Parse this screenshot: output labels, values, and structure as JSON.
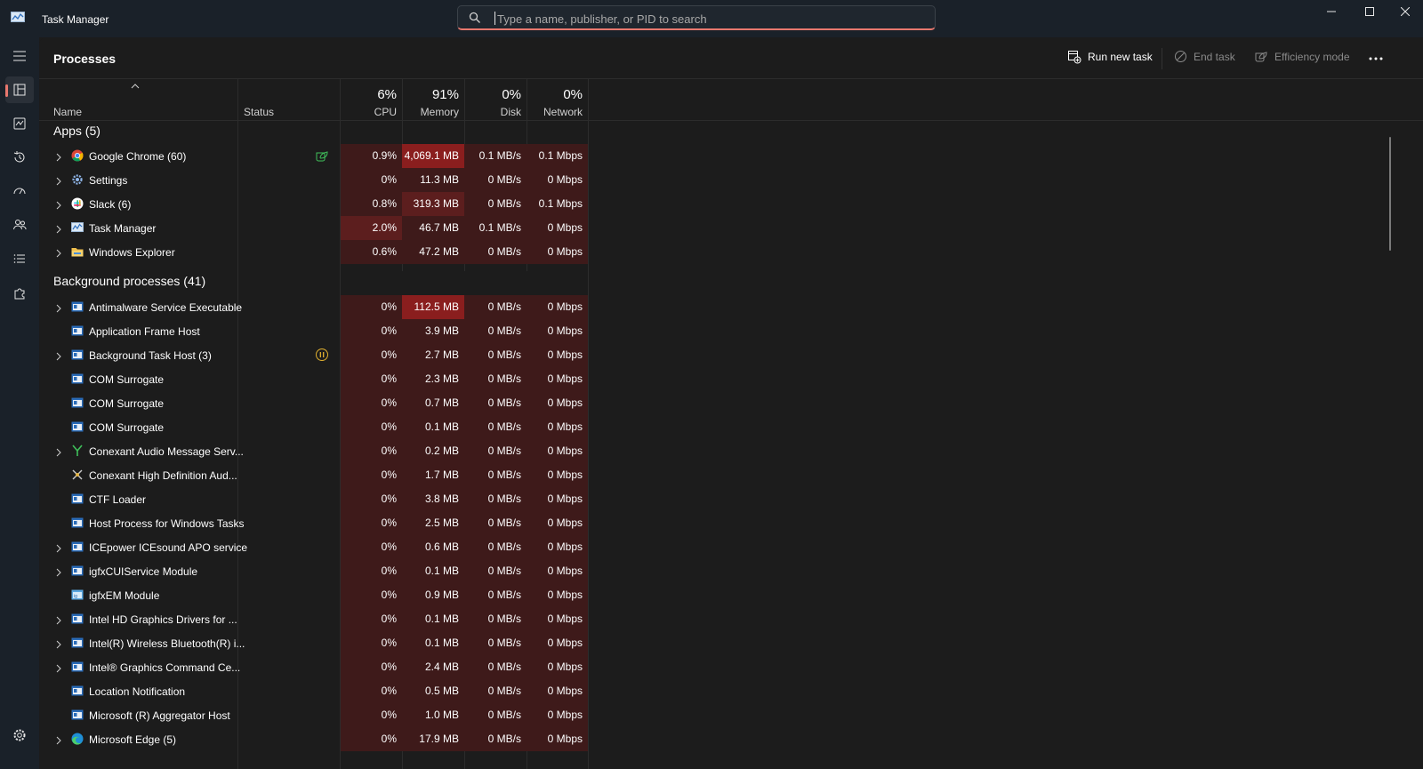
{
  "window": {
    "title": "Task Manager"
  },
  "search": {
    "placeholder": "Type a name, publisher, or PID to search"
  },
  "page": {
    "title": "Processes"
  },
  "toolbar": {
    "run_new_task": "Run new task",
    "end_task": "End task",
    "efficiency_mode": "Efficiency mode"
  },
  "columns": {
    "name": "Name",
    "status": "Status",
    "cpu": {
      "pct": "6%",
      "label": "CPU"
    },
    "memory": {
      "pct": "91%",
      "label": "Memory"
    },
    "disk": {
      "pct": "0%",
      "label": "Disk"
    },
    "network": {
      "pct": "0%",
      "label": "Network"
    }
  },
  "groups": {
    "apps": "Apps (5)",
    "background": "Background processes (41)"
  },
  "colors": {
    "accent": "#e8786e",
    "heat_low": "#3e1a1a",
    "heat_mid": "#5c1e1e",
    "heat_high": "#8a1e1e"
  },
  "rows": [
    {
      "name": "Google Chrome (60)",
      "icon": "chrome-icon",
      "expandable": true,
      "status": "efficiency-mode-icon",
      "cpu": "0.9%",
      "memory": "4,069.1 MB",
      "disk": "0.1 MB/s",
      "network": "0.1 Mbps",
      "memHeat": "high"
    },
    {
      "name": "Settings",
      "icon": "settings-gear-icon",
      "expandable": true,
      "cpu": "0%",
      "memory": "11.3 MB",
      "disk": "0 MB/s",
      "network": "0 Mbps"
    },
    {
      "name": "Slack (6)",
      "icon": "slack-icon",
      "expandable": true,
      "cpu": "0.8%",
      "memory": "319.3 MB",
      "disk": "0 MB/s",
      "network": "0.1 Mbps",
      "memHeat": "mid"
    },
    {
      "name": "Task Manager",
      "icon": "task-manager-icon",
      "expandable": true,
      "cpu": "2.0%",
      "memory": "46.7 MB",
      "disk": "0.1 MB/s",
      "network": "0 Mbps",
      "cpuHeat": "mid"
    },
    {
      "name": "Windows Explorer",
      "icon": "folder-icon",
      "expandable": true,
      "cpu": "0.6%",
      "memory": "47.2 MB",
      "disk": "0 MB/s",
      "network": "0 Mbps"
    },
    {
      "name": "Antimalware Service Executable",
      "icon": "window-app-icon",
      "expandable": true,
      "cpu": "0%",
      "memory": "112.5 MB",
      "disk": "0 MB/s",
      "network": "0 Mbps",
      "memHeat": "high"
    },
    {
      "name": "Application Frame Host",
      "icon": "window-app-icon",
      "expandable": false,
      "cpu": "0%",
      "memory": "3.9 MB",
      "disk": "0 MB/s",
      "network": "0 Mbps"
    },
    {
      "name": "Background Task Host (3)",
      "icon": "window-app-icon",
      "expandable": true,
      "status": "suspended-icon",
      "cpu": "0%",
      "memory": "2.7 MB",
      "disk": "0 MB/s",
      "network": "0 Mbps"
    },
    {
      "name": "COM Surrogate",
      "icon": "window-app-icon",
      "expandable": false,
      "cpu": "0%",
      "memory": "2.3 MB",
      "disk": "0 MB/s",
      "network": "0 Mbps"
    },
    {
      "name": "COM Surrogate",
      "icon": "window-app-icon",
      "expandable": false,
      "cpu": "0%",
      "memory": "0.7 MB",
      "disk": "0 MB/s",
      "network": "0 Mbps"
    },
    {
      "name": "COM Surrogate",
      "icon": "window-app-icon",
      "expandable": false,
      "cpu": "0%",
      "memory": "0.1 MB",
      "disk": "0 MB/s",
      "network": "0 Mbps"
    },
    {
      "name": "Conexant Audio Message Serv...",
      "icon": "conexant-icon",
      "expandable": true,
      "cpu": "0%",
      "memory": "0.2 MB",
      "disk": "0 MB/s",
      "network": "0 Mbps"
    },
    {
      "name": "Conexant High Definition Aud...",
      "icon": "conexant-hd-icon",
      "expandable": false,
      "cpu": "0%",
      "memory": "1.7 MB",
      "disk": "0 MB/s",
      "network": "0 Mbps"
    },
    {
      "name": "CTF Loader",
      "icon": "window-app-icon",
      "expandable": false,
      "cpu": "0%",
      "memory": "3.8 MB",
      "disk": "0 MB/s",
      "network": "0 Mbps"
    },
    {
      "name": "Host Process for Windows Tasks",
      "icon": "window-app-icon",
      "expandable": false,
      "cpu": "0%",
      "memory": "2.5 MB",
      "disk": "0 MB/s",
      "network": "0 Mbps"
    },
    {
      "name": "ICEpower ICEsound APO service",
      "icon": "window-app-icon",
      "expandable": true,
      "cpu": "0%",
      "memory": "0.6 MB",
      "disk": "0 MB/s",
      "network": "0 Mbps"
    },
    {
      "name": "igfxCUIService Module",
      "icon": "window-app-icon",
      "expandable": true,
      "cpu": "0%",
      "memory": "0.1 MB",
      "disk": "0 MB/s",
      "network": "0 Mbps"
    },
    {
      "name": "igfxEM Module",
      "icon": "igfx-icon",
      "expandable": false,
      "cpu": "0%",
      "memory": "0.9 MB",
      "disk": "0 MB/s",
      "network": "0 Mbps"
    },
    {
      "name": "Intel HD Graphics Drivers for ...",
      "icon": "window-app-icon",
      "expandable": true,
      "cpu": "0%",
      "memory": "0.1 MB",
      "disk": "0 MB/s",
      "network": "0 Mbps"
    },
    {
      "name": "Intel(R) Wireless Bluetooth(R) i...",
      "icon": "window-app-icon",
      "expandable": true,
      "cpu": "0%",
      "memory": "0.1 MB",
      "disk": "0 MB/s",
      "network": "0 Mbps"
    },
    {
      "name": "Intel® Graphics Command Ce...",
      "icon": "window-app-icon",
      "expandable": true,
      "cpu": "0%",
      "memory": "2.4 MB",
      "disk": "0 MB/s",
      "network": "0 Mbps"
    },
    {
      "name": "Location Notification",
      "icon": "window-app-icon",
      "expandable": false,
      "cpu": "0%",
      "memory": "0.5 MB",
      "disk": "0 MB/s",
      "network": "0 Mbps"
    },
    {
      "name": "Microsoft (R) Aggregator Host",
      "icon": "window-app-icon",
      "expandable": false,
      "cpu": "0%",
      "memory": "1.0 MB",
      "disk": "0 MB/s",
      "network": "0 Mbps"
    },
    {
      "name": "Microsoft Edge (5)",
      "icon": "edge-icon",
      "expandable": true,
      "cpu": "0%",
      "memory": "17.9 MB",
      "disk": "0 MB/s",
      "network": "0 Mbps"
    }
  ]
}
